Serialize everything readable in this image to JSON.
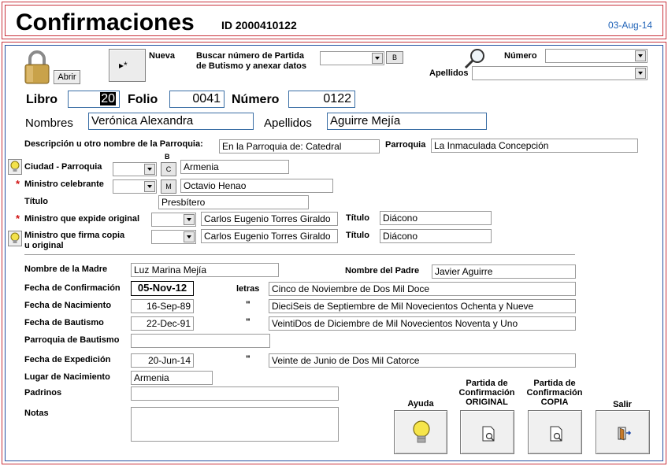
{
  "header": {
    "title": "Confirmaciones",
    "record_id": "ID 2000410122",
    "date": "03-Aug-14"
  },
  "toolbar": {
    "abrir_label": "Abrir",
    "nueva_label": "Nueva",
    "nueva_glyph": "▸*",
    "buscar_label_1": "Buscar número de Partida",
    "buscar_label_2": "de Butismo y anexar datos",
    "buscar_button": "B",
    "numero_label": "Número",
    "apellidos_label": "Apellidos"
  },
  "registro": {
    "libro_label": "Libro",
    "libro_value": "20",
    "folio_label": "Folio",
    "folio_value": "0041",
    "numero_label": "Número",
    "numero_value": "0122"
  },
  "persona": {
    "nombres_label": "Nombres",
    "nombres_value": "Verónica Alexandra",
    "apellidos_label": "Apellidos",
    "apellidos_value": "Aguirre Mejía"
  },
  "parroquia": {
    "descripcion_label": "Descripción u otro nombre de la Parroquia:",
    "descripcion_value": "En la Parroquia de: Catedral",
    "parroquia_label": "Parroquia",
    "parroquia_value": "La Inmaculada Concepción"
  },
  "ciudad": {
    "label": "Ciudad - Parroquia",
    "top_b": "B",
    "button_c": "C",
    "value": "Armenia"
  },
  "ministro_celebrante": {
    "label": "Ministro celebrante",
    "button_m": "M",
    "value": "Octavio Henao"
  },
  "titulo_celebrante": {
    "label": "Título",
    "value": "Presbítero"
  },
  "ministro_expide": {
    "label": "Ministro que expide original",
    "value": "Carlos Eugenio Torres Giraldo",
    "titulo_label": "Título",
    "titulo_value": "Diácono"
  },
  "ministro_firma": {
    "label_1": "Ministro que firma copia",
    "label_2": "u original",
    "value": "Carlos Eugenio Torres Giraldo",
    "titulo_label": "Título",
    "titulo_value": "Diácono"
  },
  "padres": {
    "madre_label": "Nombre de la Madre",
    "madre_value": "Luz Marina Mejía",
    "padre_label": "Nombre del Padre",
    "padre_value": "Javier Aguirre"
  },
  "fechas": {
    "confirmacion_label": "Fecha de Confirmación",
    "confirmacion_value": "05-Nov-12",
    "letras_label": "letras",
    "confirmacion_letras": "Cinco de Noviembre de Dos Mil Doce",
    "nacimiento_label": "Fecha de Nacimiento",
    "nacimiento_value": "16-Sep-89",
    "ditto": "\"",
    "nacimiento_letras": "DieciSeis de Septiembre de Mil Novecientos Ochenta y Nueve",
    "bautismo_label": "Fecha de Bautismo",
    "bautismo_value": "22-Dec-91",
    "bautismo_letras": "VeintiDos de Diciembre de Mil Novecientos Noventa y Uno",
    "parroquia_bautismo_label": "Parroquia de Bautismo",
    "parroquia_bautismo_value": "",
    "expedicion_label": "Fecha de Expedición",
    "expedicion_value": "20-Jun-14",
    "expedicion_letras": "Veinte de Junio de Dos Mil Catorce"
  },
  "otros": {
    "lugar_label": "Lugar de Nacimiento",
    "lugar_value": "Armenia",
    "padrinos_label": "Padrinos",
    "padrinos_value": "",
    "notas_label": "Notas",
    "notas_value": ""
  },
  "acciones": {
    "ayuda": "Ayuda",
    "original_1": "Partida de",
    "original_2": "Confirmación",
    "original_3": "ORIGINAL",
    "copia_1": "Partida de",
    "copia_2": "Confirmación",
    "copia_3": "COPIA",
    "salir": "Salir"
  },
  "colors": {
    "frame_red": "#c8323c",
    "frame_blue": "#2450a0",
    "date_blue": "#1f62b7",
    "asterisk_red": "#d01010"
  }
}
